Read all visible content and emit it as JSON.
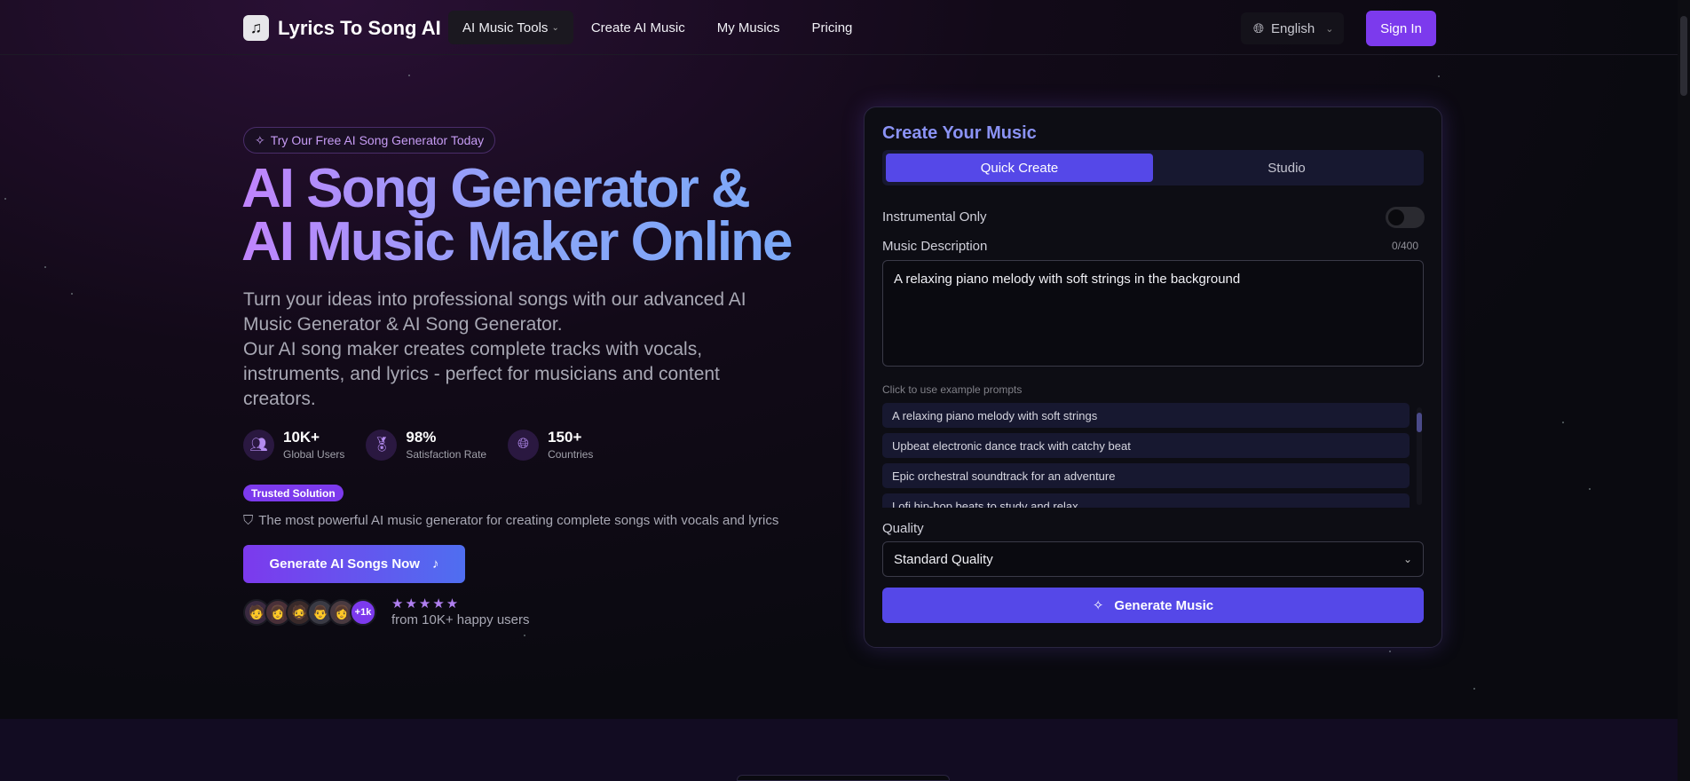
{
  "nav": {
    "logo_text": "Lyrics To Song AI",
    "links": [
      "AI Music Tools",
      "Create AI Music",
      "My Musics",
      "Pricing"
    ],
    "language": "English",
    "signin": "Sign In"
  },
  "hero": {
    "pill": "Try Our Free AI Song Generator Today",
    "title": "AI Song Generator & AI Music Maker Online",
    "desc_1": "Turn your ideas into professional songs with our advanced AI Music Generator & AI Song Generator.",
    "desc_2": "Our AI song maker creates complete tracks with vocals, instruments, and lyrics - perfect for musicians and content creators.",
    "stats": [
      {
        "value": "10K+",
        "label": "Global Users"
      },
      {
        "value": "98%",
        "label": "Satisfaction Rate"
      },
      {
        "value": "150+",
        "label": "Countries"
      }
    ],
    "trusted": "Trusted Solution",
    "powerful": "The most powerful AI music generator for creating complete songs with vocals and lyrics",
    "cta": "Generate AI Songs Now",
    "avatars_more": "+1k",
    "happy": "from 10K+ happy users"
  },
  "card": {
    "title": "Create Your Music",
    "tabs": [
      "Quick Create",
      "Studio"
    ],
    "instrumental": "Instrumental Only",
    "desc_label": "Music Description",
    "count": "0/400",
    "desc_value": "A relaxing piano melody with soft strings in the background",
    "examples_label": "Click to use example prompts",
    "examples": [
      "A relaxing piano melody with soft strings",
      "Upbeat electronic dance track with catchy beat",
      "Epic orchestral soundtrack for an adventure",
      "Lofi hip-hop beats to study and relax"
    ],
    "quality_label": "Quality",
    "quality_value": "Standard Quality",
    "generate": "Generate Music"
  },
  "colors": {
    "accent": "#7c3aed",
    "primary": "#5548e8"
  }
}
